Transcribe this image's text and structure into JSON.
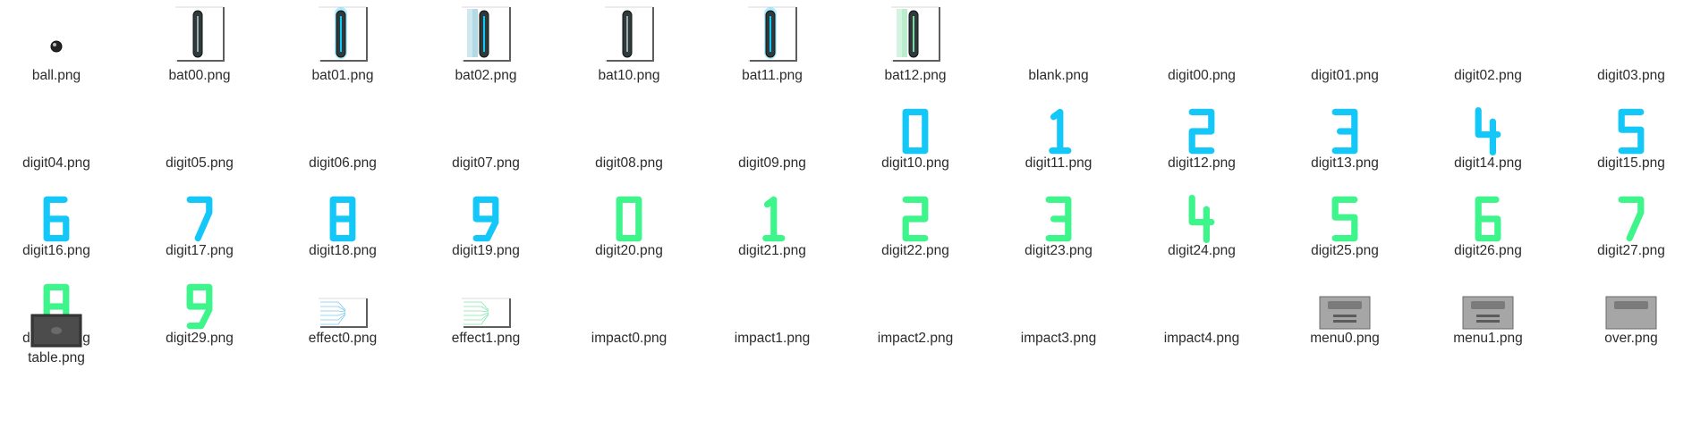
{
  "colors": {
    "blue": "#13c8f8",
    "green": "#3df58a",
    "bat_dark": "#2e3a3c",
    "frame": "#5e5e5e",
    "menu_gray": "#a6a6a6",
    "table_dark": "#3a3a3a"
  },
  "files": [
    {
      "name": "ball.png",
      "thumb": "ball"
    },
    {
      "name": "bat00.png",
      "thumb": "bat-plain-icon"
    },
    {
      "name": "bat01.png",
      "thumb": "bat-blue-glow-icon"
    },
    {
      "name": "bat02.png",
      "thumb": "bat-blue-trail-icon"
    },
    {
      "name": "bat10.png",
      "thumb": "bat-plain-icon"
    },
    {
      "name": "bat11.png",
      "thumb": "bat-blue-glow-icon"
    },
    {
      "name": "bat12.png",
      "thumb": "bat-green-trail-icon"
    },
    {
      "name": "blank.png",
      "thumb": "none"
    },
    {
      "name": "digit00.png",
      "thumb": "none"
    },
    {
      "name": "digit01.png",
      "thumb": "none"
    },
    {
      "name": "digit02.png",
      "thumb": "none"
    },
    {
      "name": "digit03.png",
      "thumb": "none"
    },
    {
      "name": "digit04.png",
      "thumb": "none"
    },
    {
      "name": "digit05.png",
      "thumb": "none"
    },
    {
      "name": "digit06.png",
      "thumb": "none"
    },
    {
      "name": "digit07.png",
      "thumb": "none"
    },
    {
      "name": "digit08.png",
      "thumb": "none"
    },
    {
      "name": "digit09.png",
      "thumb": "none"
    },
    {
      "name": "digit10.png",
      "thumb": "digit",
      "glyph": "0",
      "color": "blue"
    },
    {
      "name": "digit11.png",
      "thumb": "digit",
      "glyph": "1",
      "color": "blue"
    },
    {
      "name": "digit12.png",
      "thumb": "digit",
      "glyph": "2",
      "color": "blue"
    },
    {
      "name": "digit13.png",
      "thumb": "digit",
      "glyph": "3",
      "color": "blue"
    },
    {
      "name": "digit14.png",
      "thumb": "digit",
      "glyph": "4",
      "color": "blue"
    },
    {
      "name": "digit15.png",
      "thumb": "digit",
      "glyph": "5",
      "color": "blue"
    },
    {
      "name": "digit16.png",
      "thumb": "digit",
      "glyph": "6",
      "color": "blue"
    },
    {
      "name": "digit17.png",
      "thumb": "digit",
      "glyph": "7",
      "color": "blue"
    },
    {
      "name": "digit18.png",
      "thumb": "digit",
      "glyph": "8",
      "color": "blue"
    },
    {
      "name": "digit19.png",
      "thumb": "digit",
      "glyph": "9",
      "color": "blue"
    },
    {
      "name": "digit20.png",
      "thumb": "digit",
      "glyph": "0",
      "color": "green"
    },
    {
      "name": "digit21.png",
      "thumb": "digit",
      "glyph": "1",
      "color": "green"
    },
    {
      "name": "digit22.png",
      "thumb": "digit",
      "glyph": "2",
      "color": "green"
    },
    {
      "name": "digit23.png",
      "thumb": "digit",
      "glyph": "3",
      "color": "green"
    },
    {
      "name": "digit24.png",
      "thumb": "digit",
      "glyph": "4",
      "color": "green"
    },
    {
      "name": "digit25.png",
      "thumb": "digit",
      "glyph": "5",
      "color": "green"
    },
    {
      "name": "digit26.png",
      "thumb": "digit",
      "glyph": "6",
      "color": "green"
    },
    {
      "name": "digit27.png",
      "thumb": "digit",
      "glyph": "7",
      "color": "green"
    },
    {
      "name": "digit28.png",
      "thumb": "digit",
      "glyph": "8",
      "color": "green"
    },
    {
      "name": "digit29.png",
      "thumb": "digit",
      "glyph": "9",
      "color": "green"
    },
    {
      "name": "effect0.png",
      "thumb": "effect-blue-icon"
    },
    {
      "name": "effect1.png",
      "thumb": "effect-green-icon"
    },
    {
      "name": "impact0.png",
      "thumb": "none"
    },
    {
      "name": "impact1.png",
      "thumb": "none"
    },
    {
      "name": "impact2.png",
      "thumb": "none"
    },
    {
      "name": "impact3.png",
      "thumb": "none"
    },
    {
      "name": "impact4.png",
      "thumb": "none"
    },
    {
      "name": "menu0.png",
      "thumb": "menu-icon"
    },
    {
      "name": "menu1.png",
      "thumb": "menu-icon"
    },
    {
      "name": "over.png",
      "thumb": "game-over-icon"
    },
    {
      "name": "table.png",
      "thumb": "table-icon"
    }
  ]
}
